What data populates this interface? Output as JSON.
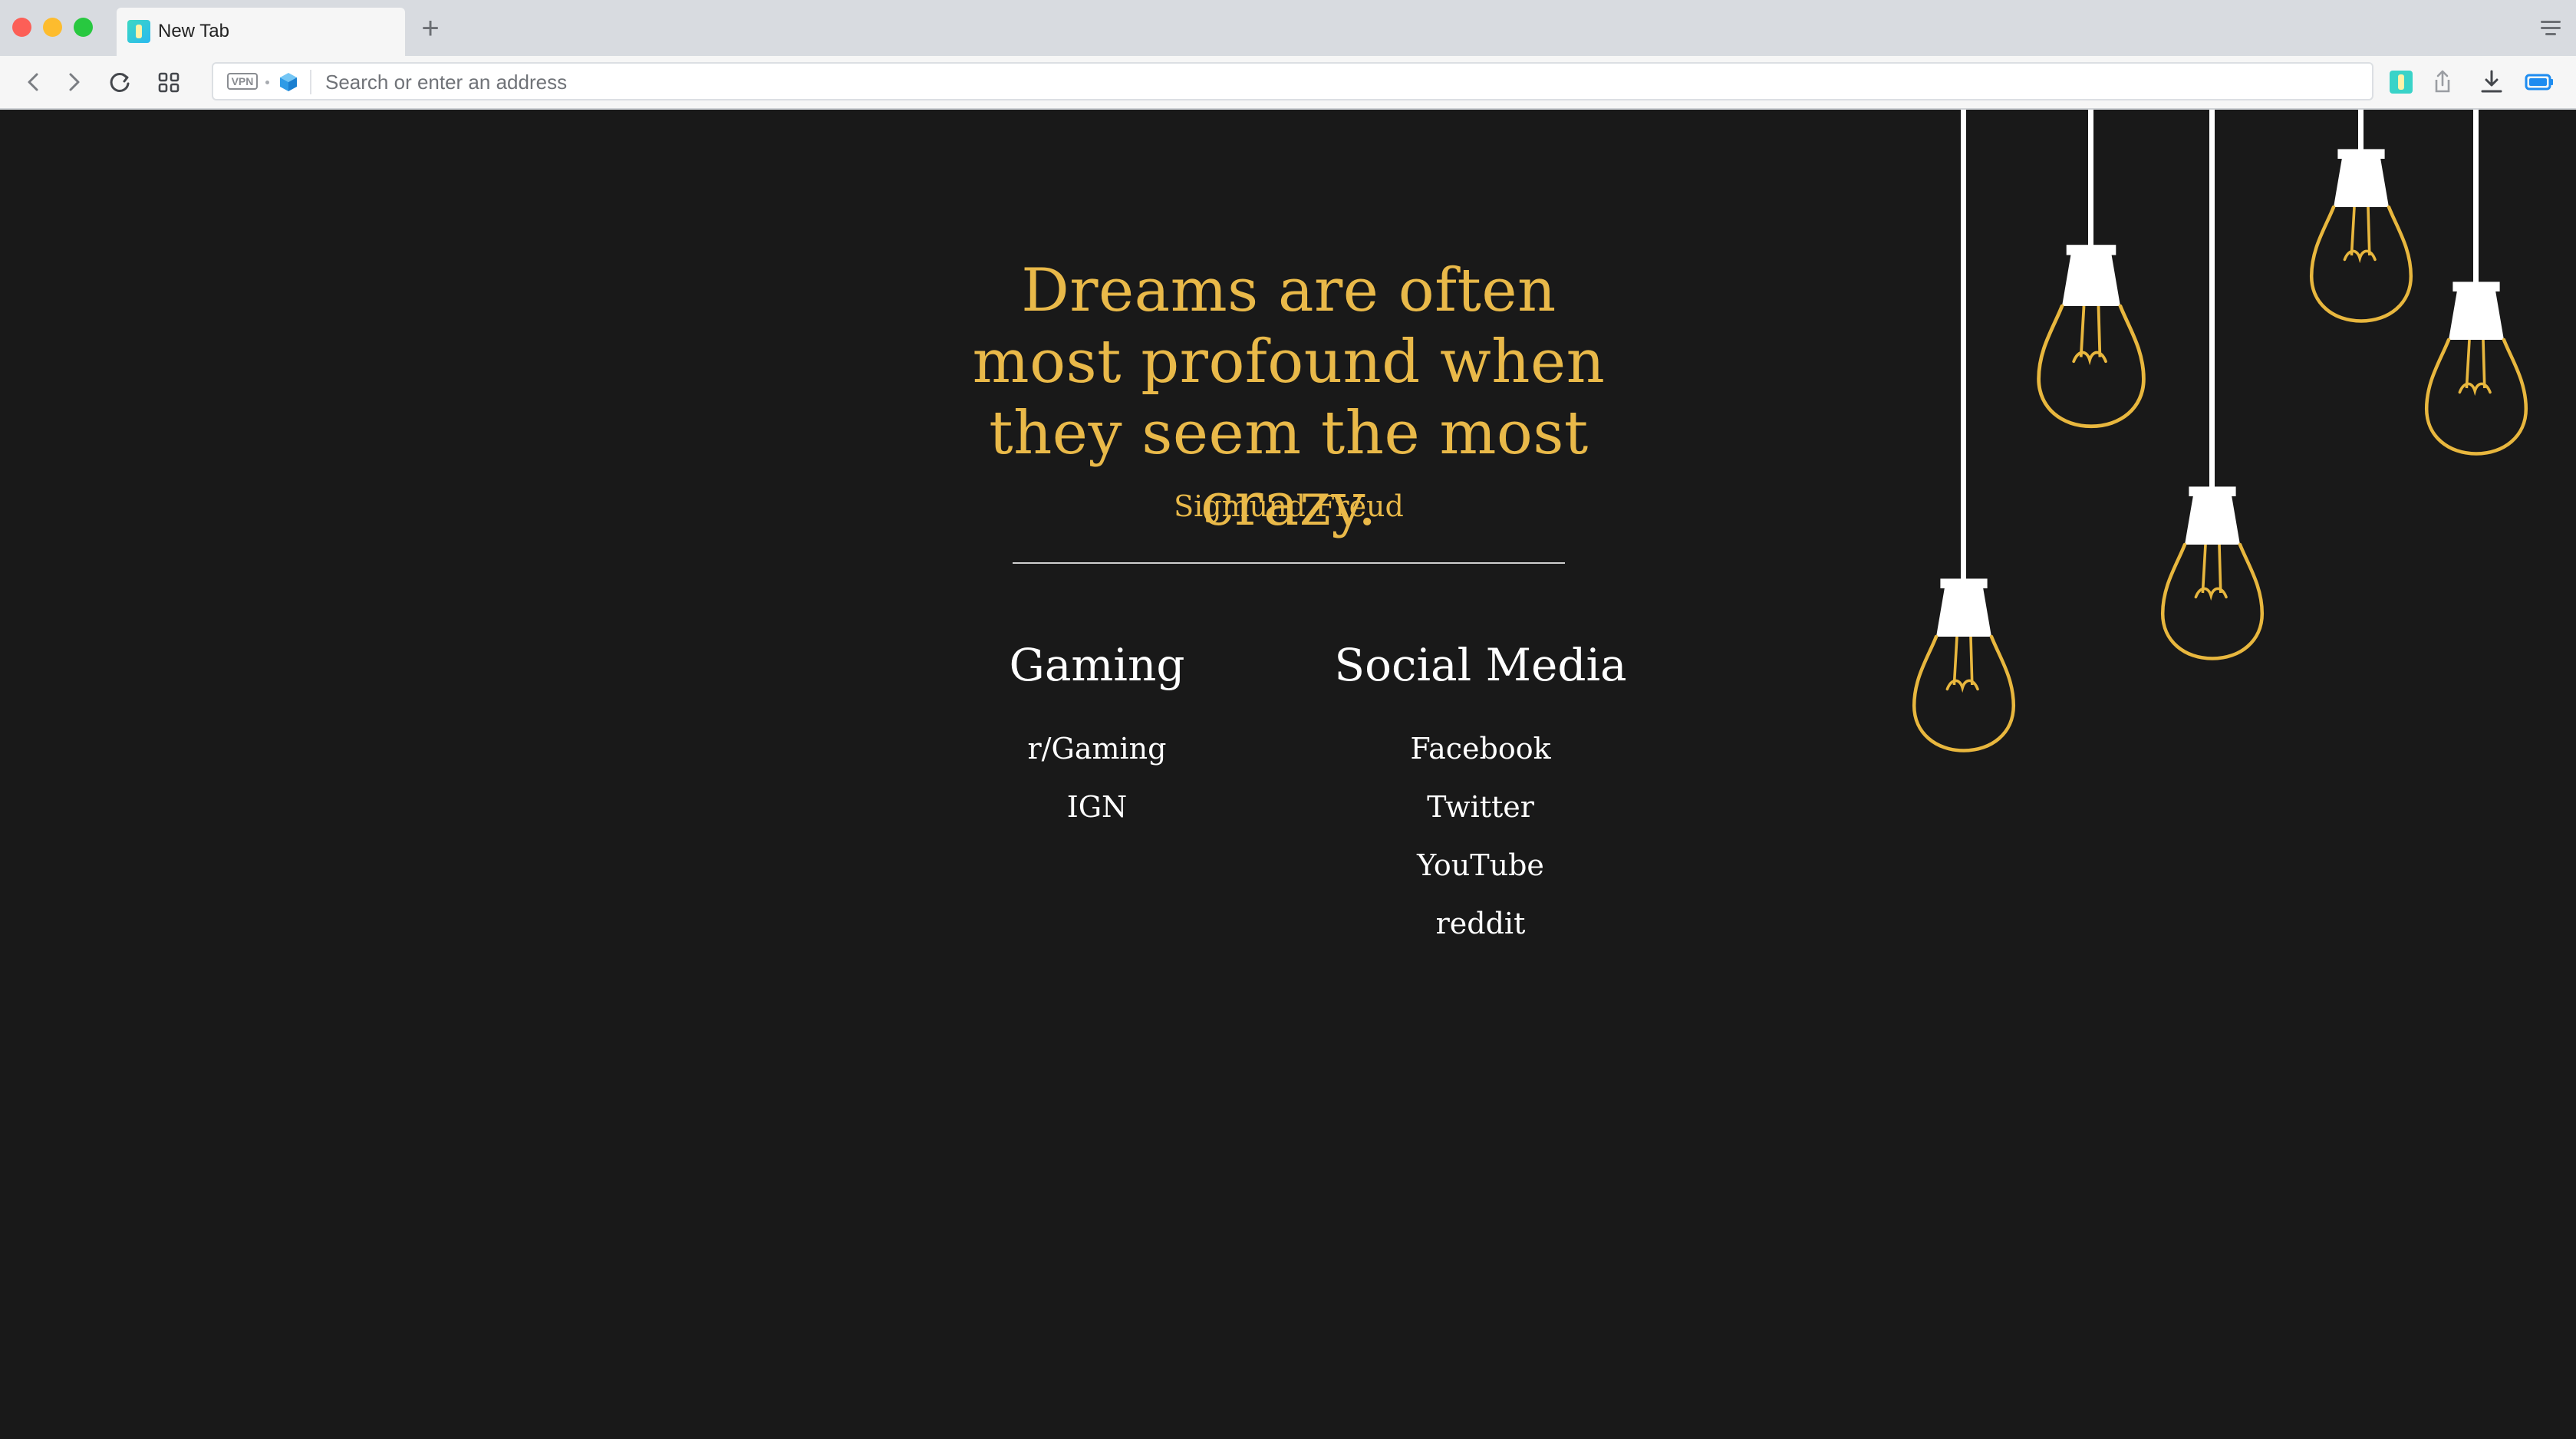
{
  "browser": {
    "tab_title": "New Tab",
    "new_tab_symbol": "+",
    "vpn_label": "VPN",
    "address_placeholder": "Search or enter an address",
    "address_value": ""
  },
  "page": {
    "quote": "Dreams are often most profound when they seem the most crazy.",
    "author": "Sigmund Freud",
    "sections": [
      {
        "heading": "Gaming",
        "links": [
          "r/Gaming",
          "IGN"
        ]
      },
      {
        "heading": "Social Media",
        "links": [
          "Facebook",
          "Twitter",
          "YouTube",
          "reddit"
        ]
      }
    ]
  },
  "colors": {
    "background": "#191919",
    "quote_gold": "#e9b949",
    "link_white": "#ffffff",
    "bulb_outline": "#e8b73e"
  },
  "icons": {
    "traffic_lights": [
      "close-icon",
      "minimize-icon",
      "zoom-icon"
    ],
    "toolbar_left": [
      "back-icon",
      "forward-icon",
      "reload-icon",
      "speed-dial-icon"
    ],
    "toolbar_right": [
      "extension-icon",
      "share-icon",
      "download-icon",
      "battery-icon"
    ],
    "decoration": "hanging-lightbulb-icon"
  }
}
